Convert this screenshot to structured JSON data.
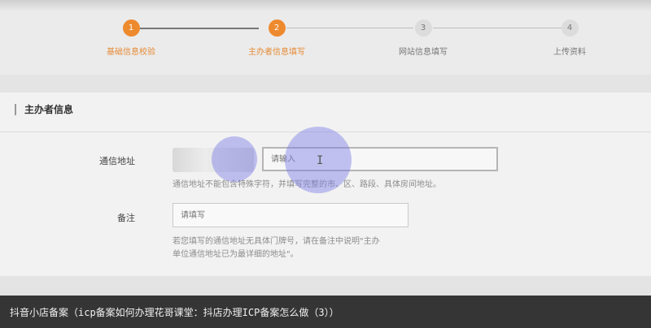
{
  "steps": [
    {
      "number": "1",
      "label": "基础信息校验",
      "state": "done"
    },
    {
      "number": "2",
      "label": "主办者信息填写",
      "state": "active"
    },
    {
      "number": "3",
      "label": "网站信息填写",
      "state": "todo"
    },
    {
      "number": "4",
      "label": "上传资料",
      "state": "todo"
    }
  ],
  "section": {
    "title": "主办者信息"
  },
  "address": {
    "label": "通信地址",
    "placeholder": "请输入",
    "hint": "通信地址不能包含特殊字符，并填写完整的市、区、路段、具体房间地址。"
  },
  "remark": {
    "label": "备注",
    "placeholder": "请填写",
    "hint_line1": "若您填写的通信地址无具体门牌号，请在备注中说明\"主办",
    "hint_line2": "单位通信地址已为最详细的地址\"。"
  },
  "caption": "抖音小店备案（icp备案如何办理花哥课堂：抖店办理ICP备案怎么做（3））",
  "colors": {
    "accent": "#ee8a2e",
    "caption_bg": "#353535",
    "highlight": "#7d7de6"
  }
}
